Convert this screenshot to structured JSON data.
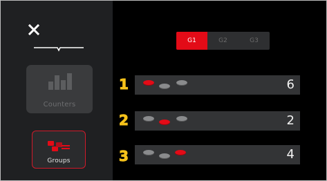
{
  "colors": {
    "accent": "#e30b17",
    "panel": "#1f2022",
    "row": "#333436",
    "inactive_dot": "#8a8b8d"
  },
  "sidebar": {
    "close_icon": "close-icon",
    "counters": {
      "label": "Counters",
      "icon": "bar-chart-icon"
    },
    "groups": {
      "label": "Groups",
      "icon": "groups-icon"
    }
  },
  "group_tabs": [
    {
      "label": "G1",
      "active": true
    },
    {
      "label": "G2",
      "active": false
    },
    {
      "label": "G3",
      "active": false
    }
  ],
  "rows": [
    {
      "number": "1",
      "count": "6",
      "active_dot": 0
    },
    {
      "number": "2",
      "count": "2",
      "active_dot": 1
    },
    {
      "number": "3",
      "count": "4",
      "active_dot": 2
    }
  ]
}
